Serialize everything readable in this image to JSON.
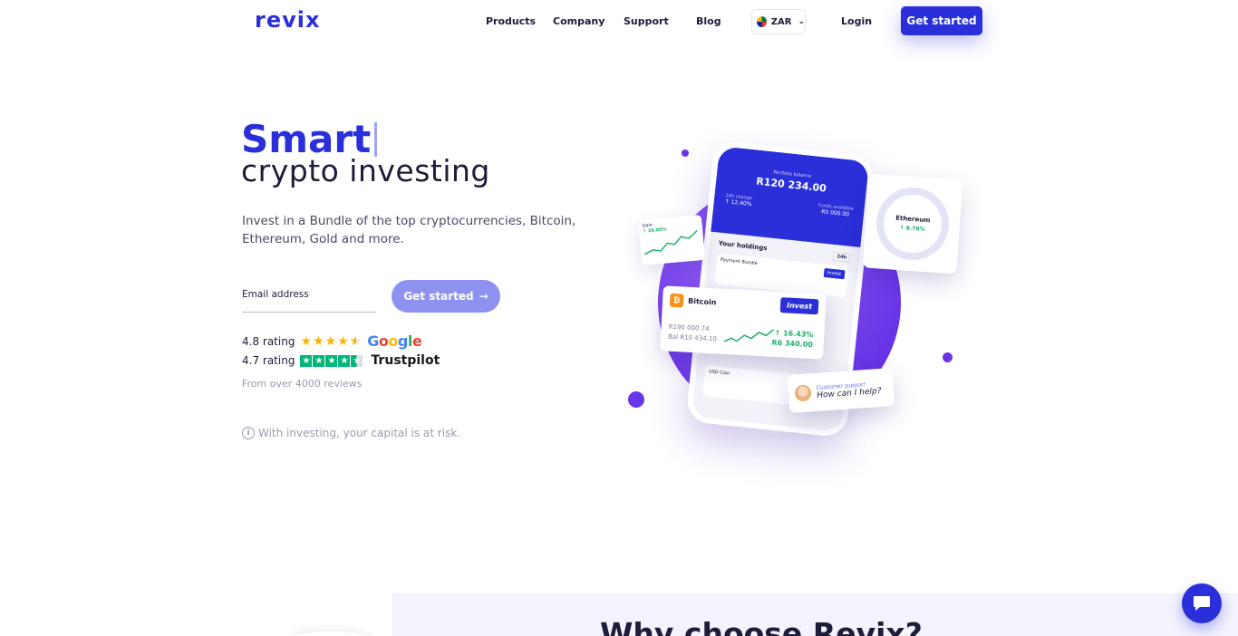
{
  "nav": {
    "logo": "revix",
    "products": "Products",
    "company": "Company",
    "support": "Support",
    "blog": "Blog",
    "currency": "ZAR",
    "login": "Login",
    "cta": "Get started"
  },
  "hero": {
    "title_highlight": "Smart",
    "title_rest": "crypto investing",
    "description": "Invest in a Bundle of the top cryptocurrencies, Bitcoin, Ethereum, Gold and more.",
    "email_placeholder": "Email address",
    "cta": "Get started",
    "cta_arrow": "→",
    "google_rating": "4.8 rating",
    "google_rating_value": 4.8,
    "google_brand": "Google",
    "trustpilot_rating": "4.7 rating",
    "trustpilot_rating_value": 4.7,
    "trustpilot_brand": "Trustpilot",
    "reviews": "From over 4000 reviews",
    "risk": "With investing, your capital is at risk."
  },
  "illustration": {
    "portfolio_label": "Portfolio balance",
    "portfolio_balance": "R120 234.00",
    "change_label": "24h change",
    "change_value": "↑ 12.40%",
    "funds_label": "Funds available",
    "funds_value": "R5 000.00",
    "holdings_title": "Your holdings",
    "holdings_period": "24h",
    "holding_1": "Payment Bundle",
    "holding_invest": "Invest",
    "gain_label": "Gain",
    "gain_value": "↑ 26.80%",
    "btc_name": "Bitcoin",
    "btc_invest": "Invest",
    "btc_value_1": "R190 000.74",
    "btc_value_2": "Bal R10 434.10",
    "btc_pct": "↑ 16.43%",
    "btc_gain": "R6 340.00",
    "eth_name": "Ethereum",
    "eth_pct": "↑ 8.78%",
    "usdc_name": "USD Coin",
    "support_title": "Customer support",
    "support_question": "How can I help?"
  },
  "why": {
    "title_prefix": "Why choose ",
    "title_brand": "Revix?"
  },
  "colors": {
    "brand": "#2b2fd9",
    "cta_light": "#8e91f0",
    "gain_green": "#1fae6a"
  },
  "icons": {
    "chat": "chat-bubble-icon",
    "info": "info-icon",
    "chevron": "chevron-down-icon"
  }
}
